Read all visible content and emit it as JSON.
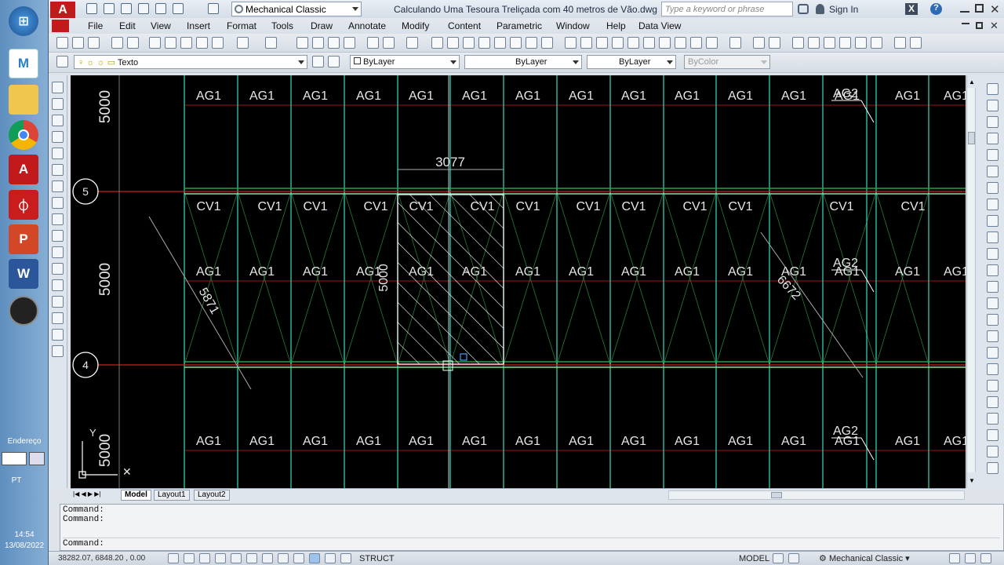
{
  "taskbar": {
    "apps": [
      "start-orb",
      "maple",
      "file-explorer",
      "chrome",
      "autocad",
      "acrobat",
      "powerpoint",
      "word",
      "media-player"
    ],
    "address_label": "Endereço",
    "lang": "PT",
    "clock_time": "14:54",
    "clock_date": "13/08/2022"
  },
  "titlebar": {
    "workspace": "Mechanical Classic",
    "document_title": "Calculando Uma Tesoura Treliçada com 40 metros de Vão.dwg",
    "search_placeholder": "Type a keyword or phrase",
    "sign_in": "Sign In"
  },
  "menu": [
    "File",
    "Edit",
    "View",
    "Insert",
    "Format",
    "Tools",
    "Draw",
    "Annotate",
    "Modify",
    "Content",
    "Parametric",
    "Window",
    "Help",
    "Data View"
  ],
  "properties_bar": {
    "layer": "Texto",
    "color": "ByLayer",
    "linetype": "ByLayer",
    "lineweight": "ByLayer",
    "plotstyle": "ByColor"
  },
  "drawing": {
    "grid_bubbles": [
      "5",
      "4"
    ],
    "dim_vertical": "5000",
    "dim_horizontal": "3077",
    "dim_diag_left": "5871",
    "dim_diag_right": "6672",
    "purlin_label": "AG1",
    "purlin_label_2": "AG2",
    "truss_label": "CV1",
    "ucs_y": "Y"
  },
  "layout_tabs": [
    "Model",
    "Layout1",
    "Layout2"
  ],
  "command_lines": [
    "Command:",
    "Command:",
    "Command:"
  ],
  "status": {
    "coords": "38282.07, 6848.20 , 0.00",
    "struct": "STRUCT",
    "model": "MODEL",
    "workspace": "Mechanical Classic"
  },
  "colors": {
    "line_cyan": "#2ecfb3",
    "line_green": "#2f9a4a",
    "line_red": "#cc2020",
    "text_white": "#e6e6e6"
  }
}
